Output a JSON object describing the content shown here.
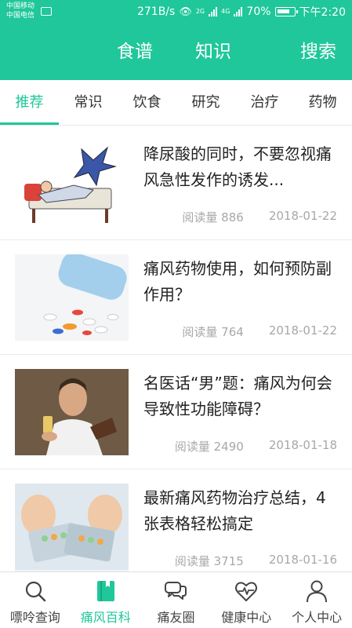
{
  "status_bar": {
    "carrier_1": "中国移动",
    "carrier_2": "中国电信",
    "speed": "271B/s",
    "network_1": "2G",
    "network_2": "4G",
    "battery": "70%",
    "time": "下午2:20"
  },
  "header": {
    "recipes_label": "食谱",
    "knowledge_label": "知识",
    "search_label": "搜索"
  },
  "tabs": [
    {
      "label": "推荐",
      "active": true
    },
    {
      "label": "常识",
      "active": false
    },
    {
      "label": "饮食",
      "active": false
    },
    {
      "label": "研究",
      "active": false
    },
    {
      "label": "治疗",
      "active": false
    },
    {
      "label": "药物",
      "active": false
    }
  ],
  "articles": [
    {
      "title": "降尿酸的同时，不要忽视痛风急性发作的诱发...",
      "read_label": "阅读量",
      "read_count": "886",
      "date": "2018-01-22"
    },
    {
      "title": "痛风药物使用，如何预防副作用？",
      "read_label": "阅读量",
      "read_count": "764",
      "date": "2018-01-22"
    },
    {
      "title": "名医话“男”题：痛风为何会导致性功能障碍？",
      "read_label": "阅读量",
      "read_count": "2490",
      "date": "2018-01-18"
    },
    {
      "title": "最新痛风药物治疗总结，4张表格轻松搞定",
      "read_label": "阅读量",
      "read_count": "3715",
      "date": "2018-01-16"
    }
  ],
  "bottom_nav": [
    {
      "label": "嘌呤查询",
      "icon": "search-icon",
      "active": false
    },
    {
      "label": "痛风百科",
      "icon": "book-icon",
      "active": true
    },
    {
      "label": "痛友圈",
      "icon": "chat-bubbles-icon",
      "active": false
    },
    {
      "label": "健康中心",
      "icon": "heart-pulse-icon",
      "active": false
    },
    {
      "label": "个人中心",
      "icon": "person-icon",
      "active": false
    }
  ],
  "colors": {
    "accent": "#1fc79a",
    "meta_text": "#a8a8a8"
  }
}
